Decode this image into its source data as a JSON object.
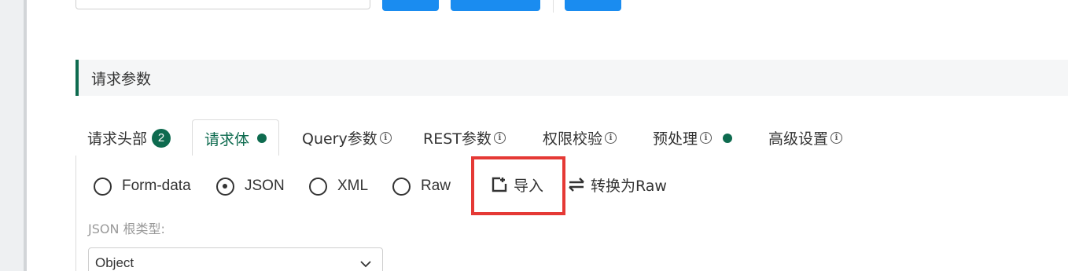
{
  "section": {
    "title": "请求参数"
  },
  "tabs": [
    {
      "label": "请求头部",
      "badge": "2"
    },
    {
      "label": "请求体",
      "dot": true
    },
    {
      "label": "Query参数",
      "info": true
    },
    {
      "label": "REST参数",
      "info": true
    },
    {
      "label": "权限校验",
      "info": true
    },
    {
      "label": "预处理",
      "info": true,
      "dot": true
    },
    {
      "label": "高级设置",
      "info": true
    }
  ],
  "body_types": [
    {
      "label": "Form-data",
      "checked": false
    },
    {
      "label": "JSON",
      "checked": true
    },
    {
      "label": "XML",
      "checked": false
    },
    {
      "label": "Raw",
      "checked": false
    }
  ],
  "actions": {
    "import_label": "导入",
    "convert_label": "转换为Raw"
  },
  "json_root": {
    "label": "JSON 根类型:",
    "value": "Object"
  },
  "colors": {
    "accent": "#0e6b4f",
    "primary_button": "#1a8cf0",
    "highlight": "#e53935"
  }
}
